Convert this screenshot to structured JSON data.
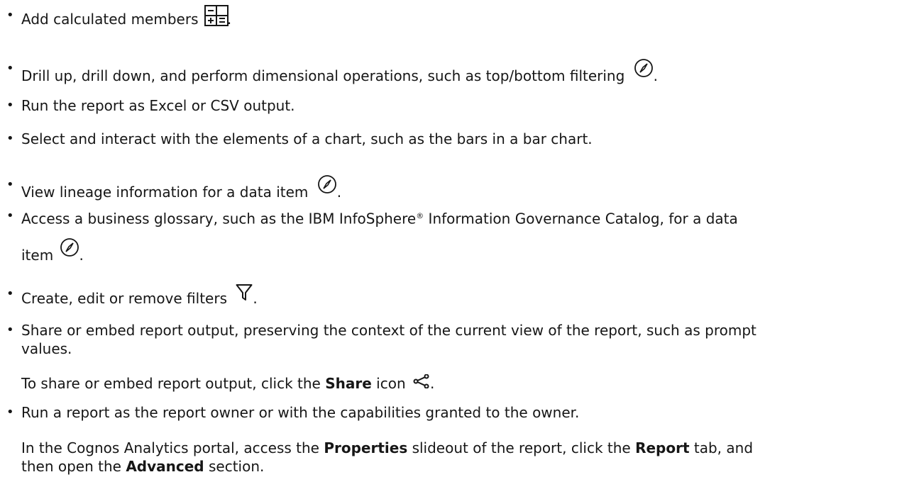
{
  "items": [
    {
      "text": "Add calculated members",
      "suffix": ".",
      "icon": "calculated-members-icon"
    },
    {
      "text": "Drill up, drill down, and perform dimensional operations, such as top/bottom filtering",
      "suffix": ".",
      "icon": "compass-icon"
    },
    {
      "text": "Run the report as Excel or CSV output."
    },
    {
      "text": "Select and interact with the elements of a chart, such as the bars in a bar chart."
    },
    {
      "text": "View lineage information for a data item",
      "suffix": ".",
      "icon": "compass-icon"
    },
    {
      "text_line1": "Access a business glossary, such as the IBM InfoSphere",
      "reg": "®",
      "text_line1b": " Information Governance Catalog, for a data",
      "text_line2": "item",
      "suffix": ".",
      "icon": "compass-icon"
    },
    {
      "text": "Create, edit or remove filters",
      "suffix": ".",
      "icon": "filter-icon"
    },
    {
      "text_line1": "Share or embed report output, preserving the context of the current view of the report, such as prompt",
      "text_line2": "values."
    },
    {
      "text": "Run a report as the report owner or with the capabilities granted to the owner."
    }
  ],
  "share_para": {
    "before": "To share or embed report output, click the ",
    "bold": "Share",
    "after": " icon",
    "suffix": ".",
    "icon": "share-icon"
  },
  "owner_para": {
    "t1": "In the Cognos Analytics portal, access the ",
    "b1": "Properties",
    "t2": " slideout of the report, click the ",
    "b2": "Report",
    "t3": " tab, and",
    "line2_t1": "then open the ",
    "line2_b1": "Advanced",
    "line2_t2": " section."
  },
  "bullet_char": "•",
  "colors": {
    "text": "#161616",
    "background": "#ffffff"
  }
}
